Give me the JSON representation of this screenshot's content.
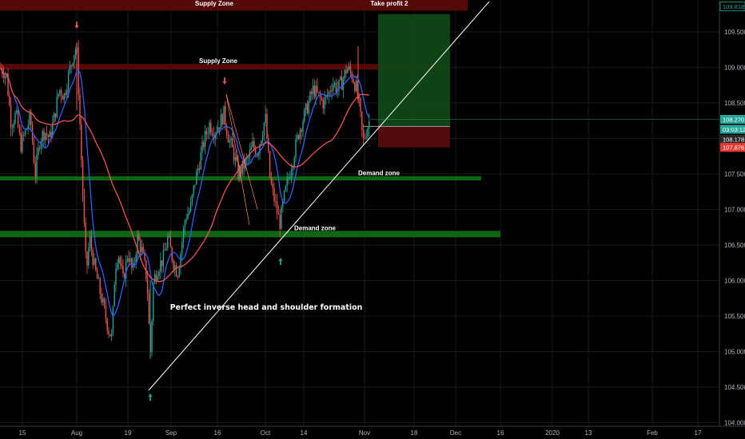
{
  "chart_data": {
    "type": "candlestick",
    "title": "",
    "y_axis": {
      "position": "right",
      "ticks": [
        104.0,
        104.5,
        105.0,
        105.5,
        106.0,
        106.5,
        107.0,
        107.5,
        108.0,
        108.5,
        109.0,
        109.5
      ],
      "ylim": [
        103.95,
        109.95
      ]
    },
    "x_axis": {
      "tick_labels": [
        "15",
        "Aug",
        "19",
        "Sep",
        "16",
        "Oct",
        "14",
        "Nov",
        "18",
        "Dec",
        "16",
        "2020",
        "13",
        "Feb",
        "17"
      ]
    },
    "price_tags": [
      {
        "label": "109.818",
        "value": 109.818,
        "bg": "#000000",
        "fg": "#26a69a",
        "border": "#26a69a"
      },
      {
        "label": "108.270",
        "value": 108.27,
        "bg": "#26a69a",
        "fg": "#ffffff"
      },
      {
        "label": "03:03:12",
        "value": 108.13,
        "bg": "#26a69a",
        "fg": "#ffffff"
      },
      {
        "label": "108.178",
        "value": 107.99,
        "bg": "#2a2a2a",
        "fg": "#ffffff"
      },
      {
        "label": "107.876",
        "value": 107.876,
        "bg": "#e53935",
        "fg": "#ffffff"
      }
    ],
    "zones": [
      {
        "label": "Supply Zone",
        "type": "supply",
        "y_top": 109.95,
        "y_bottom": 109.8,
        "x_start": "15",
        "x_end": "Dec"
      },
      {
        "label": "Supply Zone",
        "type": "supply",
        "y_top": 109.05,
        "y_bottom": 108.97,
        "x_start": "15",
        "x_end": "Nov"
      },
      {
        "label": "Demand zone",
        "type": "demand",
        "y_top": 107.47,
        "y_bottom": 107.41,
        "x_start": "15",
        "x_end": "16"
      },
      {
        "label": "Demand zone",
        "type": "demand",
        "y_top": 106.7,
        "y_bottom": 106.61,
        "x_start": "15",
        "x_end": "16"
      }
    ],
    "position": {
      "label": "Take profit 2",
      "entry": 108.17,
      "target": 109.818,
      "stop": 107.876
    },
    "annotation": "Perfect inverse head and shoulder formation",
    "moving_averages": [
      {
        "color": "#2962ff"
      },
      {
        "color": "#ef5350"
      }
    ],
    "trendline": {
      "color": "#ffffff"
    },
    "colors": {
      "up": "#26a69a",
      "down": "#ef5350",
      "background": "#000000",
      "grid": "#1a1a1a"
    }
  }
}
